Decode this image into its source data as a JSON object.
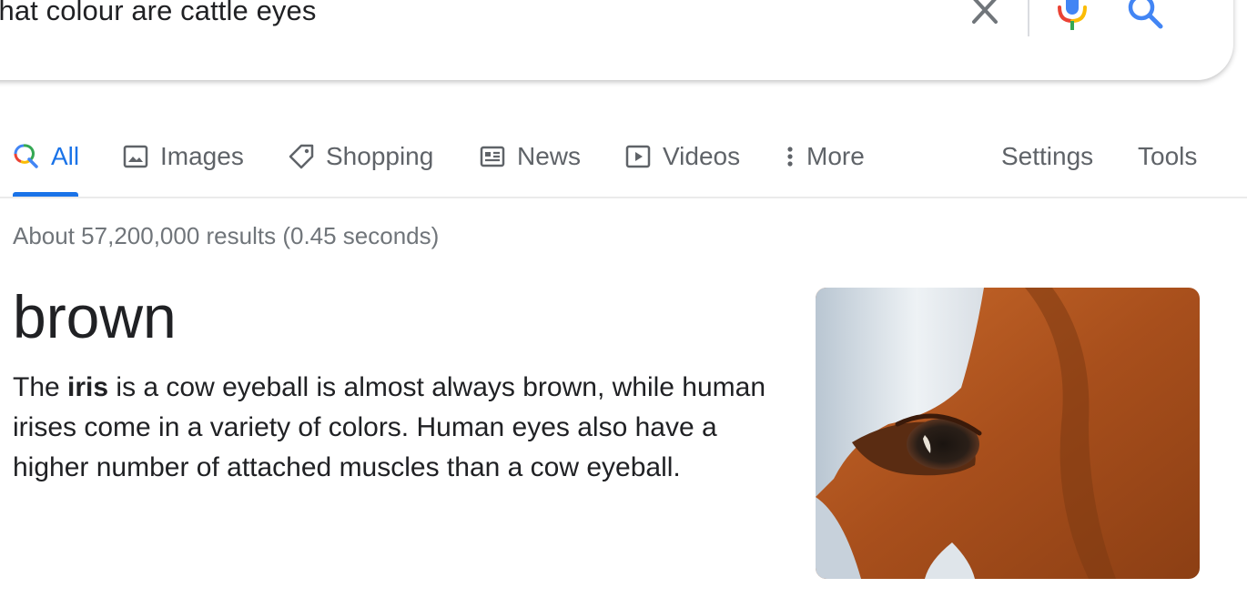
{
  "search": {
    "query": "what colour are cattle eyes",
    "clear_icon": "close-icon",
    "mic_icon": "microphone-icon",
    "search_icon": "search-icon"
  },
  "tabs": [
    {
      "label": "All",
      "icon": "search-icon",
      "active": true
    },
    {
      "label": "Images",
      "icon": "image-icon"
    },
    {
      "label": "Shopping",
      "icon": "tag-icon"
    },
    {
      "label": "News",
      "icon": "newspaper-icon"
    },
    {
      "label": "Videos",
      "icon": "play-icon"
    },
    {
      "label": "More",
      "icon": "more-vert-icon"
    },
    {
      "label": "Settings"
    },
    {
      "label": "Tools"
    }
  ],
  "stats": "About 57,200,000 results (0.45 seconds)",
  "featured": {
    "answer": "brown",
    "desc_before": "The ",
    "desc_bold": "iris",
    "desc_after": " is a cow eyeball is almost always brown, while human irises come in a variety of colors. Human eyes also have a higher number of attached muscles than a cow eyeball."
  },
  "colors": {
    "accent": "#1a73e8",
    "text": "#202124",
    "muted": "#5f6368"
  }
}
